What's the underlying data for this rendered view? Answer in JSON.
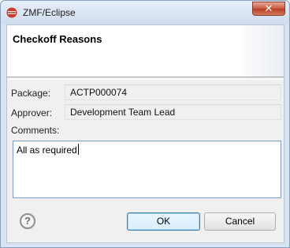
{
  "window": {
    "title": "ZMF/Eclipse",
    "close_glyph": "✕"
  },
  "banner": {
    "title": "Checkoff Reasons"
  },
  "form": {
    "package_label": "Package:",
    "package_value": "ACTP000074",
    "approver_label": "Approver:",
    "approver_value": "Development Team Lead",
    "comments_label": "Comments:",
    "comments_value": "All as required"
  },
  "buttons": {
    "help_glyph": "?",
    "ok_label": "OK",
    "cancel_label": "Cancel"
  },
  "colors": {
    "accent": "#3c7fb1",
    "close": "#c75a42",
    "app_icon": "#d03a2a"
  }
}
